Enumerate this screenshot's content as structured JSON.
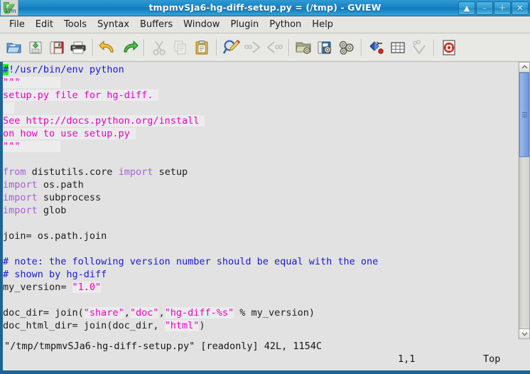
{
  "window": {
    "title": "tmpmvSJa6-hg-diff-setup.py = (/tmp) - GVIEW",
    "app_icon": "vim-logo-icon",
    "controls": [
      {
        "name": "shade-button",
        "glyph": "▲"
      },
      {
        "name": "minimize-button",
        "glyph": "–"
      },
      {
        "name": "maximize-button",
        "glyph": "＋"
      },
      {
        "name": "close-button",
        "glyph": "✕"
      }
    ]
  },
  "menubar": {
    "items": [
      {
        "label": "File"
      },
      {
        "label": "Edit"
      },
      {
        "label": "Tools"
      },
      {
        "label": "Syntax"
      },
      {
        "label": "Buffers"
      },
      {
        "label": "Window"
      },
      {
        "label": "Plugin"
      },
      {
        "label": "Python"
      },
      {
        "label": "Help"
      }
    ]
  },
  "toolbar": {
    "buttons": [
      {
        "name": "open-file-icon",
        "tip": "Open"
      },
      {
        "name": "save-as-icon",
        "tip": "Save As"
      },
      {
        "name": "save-icon",
        "tip": "Save"
      },
      {
        "name": "print-icon",
        "tip": "Print"
      },
      {
        "name": "undo-icon",
        "tip": "Undo"
      },
      {
        "name": "redo-icon",
        "tip": "Redo"
      },
      {
        "name": "cut-icon",
        "tip": "Cut"
      },
      {
        "name": "copy-icon",
        "tip": "Copy"
      },
      {
        "name": "paste-icon",
        "tip": "Paste"
      },
      {
        "name": "find-replace-icon",
        "tip": "Find and Replace"
      },
      {
        "name": "find-next-icon",
        "tip": "Find Next"
      },
      {
        "name": "find-prev-icon",
        "tip": "Find Previous"
      },
      {
        "name": "load-session-icon",
        "tip": "Load Session"
      },
      {
        "name": "save-session-icon",
        "tip": "Save Session"
      },
      {
        "name": "run-script-icon",
        "tip": "Run Script"
      },
      {
        "name": "make-icon",
        "tip": "Make"
      },
      {
        "name": "build-tags-icon",
        "tip": "Build Tags"
      },
      {
        "name": "jump-to-tag-icon",
        "tip": "Jump to Tag"
      },
      {
        "name": "help-icon",
        "tip": "Help"
      }
    ]
  },
  "editor": {
    "background": "#e2e2e2",
    "colors": {
      "comment": "#1919d6",
      "string": "#ea00c8",
      "keyword": "#a95fd8",
      "plain": "#202020",
      "cursor": "#2cf02c",
      "string_bg": "#ececec"
    },
    "lines": [
      {
        "id": 1,
        "tokens": [
          {
            "t": "#",
            "c": "cursor"
          },
          {
            "t": "!/usr/bin/env python",
            "c": "tok-comment"
          }
        ]
      },
      {
        "id": 2,
        "tokens": [
          {
            "t": "\"\"\"",
            "c": "tok-string"
          },
          {
            "t": "       ",
            "c": "tok-string"
          }
        ]
      },
      {
        "id": 3,
        "tokens": [
          {
            "t": "setup.py file for hg-diff. ",
            "c": "tok-string"
          }
        ]
      },
      {
        "id": 4,
        "tokens": [
          {
            "t": "  ",
            "c": "tok-string"
          }
        ]
      },
      {
        "id": 5,
        "tokens": [
          {
            "t": "See http://docs.python.org/install ",
            "c": "tok-string"
          }
        ]
      },
      {
        "id": 6,
        "tokens": [
          {
            "t": "on how to use setup.py ",
            "c": "tok-string"
          }
        ]
      },
      {
        "id": 7,
        "tokens": [
          {
            "t": "\"\"\"",
            "c": "tok-string"
          },
          {
            "t": "       ",
            "c": "tok-string"
          }
        ]
      },
      {
        "id": 8,
        "tokens": []
      },
      {
        "id": 9,
        "tokens": [
          {
            "t": "from",
            "c": "tok-kw"
          },
          {
            "t": " distutils.core ",
            "c": "tok-plain"
          },
          {
            "t": "import",
            "c": "tok-kw"
          },
          {
            "t": " setup",
            "c": "tok-plain"
          }
        ]
      },
      {
        "id": 10,
        "tokens": [
          {
            "t": "import",
            "c": "tok-kw"
          },
          {
            "t": " os.path",
            "c": "tok-plain"
          }
        ]
      },
      {
        "id": 11,
        "tokens": [
          {
            "t": "import",
            "c": "tok-kw"
          },
          {
            "t": " subprocess",
            "c": "tok-plain"
          }
        ]
      },
      {
        "id": 12,
        "tokens": [
          {
            "t": "import",
            "c": "tok-kw"
          },
          {
            "t": " glob",
            "c": "tok-plain"
          }
        ]
      },
      {
        "id": 13,
        "tokens": []
      },
      {
        "id": 14,
        "tokens": [
          {
            "t": "join= os.path.join",
            "c": "tok-plain"
          }
        ]
      },
      {
        "id": 15,
        "tokens": []
      },
      {
        "id": 16,
        "tokens": [
          {
            "t": "# note: the following version number should be equal with the one",
            "c": "tok-comment"
          }
        ]
      },
      {
        "id": 17,
        "tokens": [
          {
            "t": "# shown by hg-diff",
            "c": "tok-comment"
          }
        ]
      },
      {
        "id": 18,
        "tokens": [
          {
            "t": "my_version= ",
            "c": "tok-plain"
          },
          {
            "t": "\"1.0\"",
            "c": "tok-string"
          }
        ]
      },
      {
        "id": 19,
        "tokens": []
      },
      {
        "id": 20,
        "tokens": [
          {
            "t": "doc_dir= join(",
            "c": "tok-plain"
          },
          {
            "t": "\"share\"",
            "c": "tok-string"
          },
          {
            "t": ",",
            "c": "tok-plain"
          },
          {
            "t": "\"doc\"",
            "c": "tok-string"
          },
          {
            "t": ",",
            "c": "tok-plain"
          },
          {
            "t": "\"hg-diff-%s\"",
            "c": "tok-string"
          },
          {
            "t": " % my_version)",
            "c": "tok-plain"
          }
        ]
      },
      {
        "id": 21,
        "tokens": [
          {
            "t": "doc_html_dir= join(doc_dir, ",
            "c": "tok-plain"
          },
          {
            "t": "\"html\"",
            "c": "tok-string"
          },
          {
            "t": ")",
            "c": "tok-plain"
          }
        ]
      },
      {
        "id": 22,
        "tokens": []
      }
    ]
  },
  "statusline": {
    "file_info": "\"/tmp/tmpmvSJa6-hg-diff-setup.py\" [readonly] 42L, 1154C",
    "cursor_position": "1,1",
    "scroll_indicator": "Top"
  },
  "scrollbar": {
    "up_arrow_glyph": "˄",
    "down_arrow_glyph": "˅",
    "thumb_top_percent": 0,
    "thumb_height_percent": 33
  }
}
